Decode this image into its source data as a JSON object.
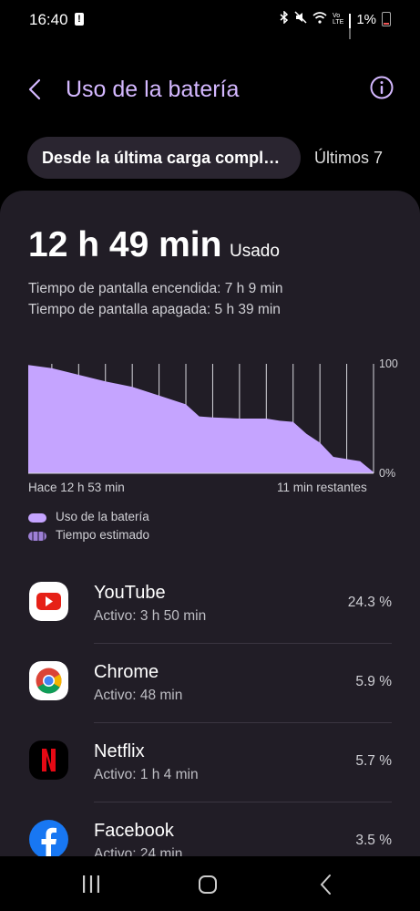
{
  "status_bar": {
    "time": "16:40",
    "battery_percent": "1%",
    "icons": [
      "bluetooth-icon",
      "mute-icon",
      "wifi-icon",
      "volte-icon",
      "signal-icon",
      "battery-icon"
    ]
  },
  "header": {
    "title": "Uso de la batería",
    "back_icon": "chevron-left-icon",
    "info_icon": "info-icon"
  },
  "tabs": [
    {
      "label": "Desde la última carga comple…",
      "active": true
    },
    {
      "label": "Últimos 7",
      "active": false
    }
  ],
  "summary": {
    "usage_time": "12 h 49 min",
    "usage_label": "Usado",
    "screen_on": "Tiempo de pantalla encendida: 7 h 9 min",
    "screen_off": "Tiempo de pantalla apagada: 5 h 39 min"
  },
  "chart_data": {
    "type": "area",
    "y_ticks": [
      "100",
      "0%"
    ],
    "ylim": [
      0,
      100
    ],
    "x_start_label": "Hace 12 h 53 min",
    "x_end_label": "11 min restantes",
    "x_hours_ago": [
      12.88,
      12.0,
      11.0,
      10.0,
      9.0,
      8.0,
      7.0,
      6.5,
      6.0,
      5.0,
      4.0,
      3.5,
      3.0,
      2.5,
      2.0,
      1.5,
      1.0,
      0.5,
      0.0
    ],
    "battery_percent": [
      99,
      96,
      90,
      84,
      79,
      71,
      63,
      52,
      51,
      50,
      50,
      48,
      47,
      36,
      28,
      15,
      13,
      11,
      1
    ],
    "legend": [
      {
        "label": "Uso de la batería",
        "color": "#c5a4ff"
      },
      {
        "label": "Tiempo estimado",
        "color": "#9e80d6"
      }
    ],
    "grid": true
  },
  "apps": [
    {
      "name": "YouTube",
      "active": "Activo: 3 h 50 min",
      "percent": "24.3 %",
      "icon": "youtube-icon"
    },
    {
      "name": "Chrome",
      "active": "Activo: 48 min",
      "percent": "5.9 %",
      "icon": "chrome-icon"
    },
    {
      "name": "Netflix",
      "active": "Activo: 1 h 4 min",
      "percent": "5.7 %",
      "icon": "netflix-icon"
    },
    {
      "name": "Facebook",
      "active": "Activo: 24 min",
      "percent": "3.5 %",
      "icon": "facebook-icon"
    }
  ],
  "nav_bar": {
    "icons": [
      "recent-apps-icon",
      "home-icon",
      "back-icon"
    ]
  }
}
